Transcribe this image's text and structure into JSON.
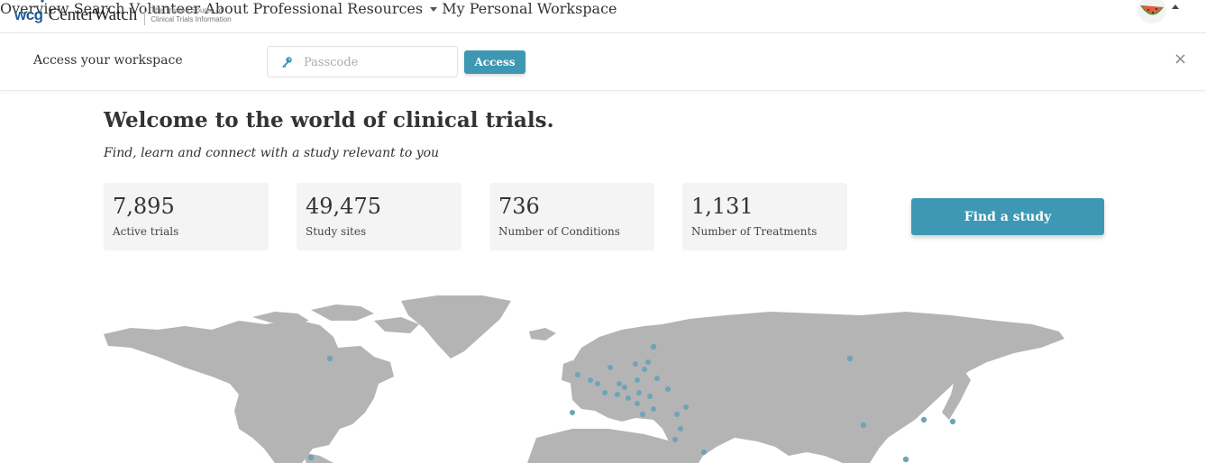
{
  "header": {
    "logo_wcg": "wcg",
    "logo_name": "CenterWatch",
    "tagline": "The Trusted Source of Clinical Trials Information",
    "nav": [
      {
        "label": "Overview"
      },
      {
        "label": "Search"
      },
      {
        "label": "Volunteer"
      },
      {
        "label": "About"
      },
      {
        "label": "Professional Resources"
      },
      {
        "label": "My Personal Workspace"
      }
    ]
  },
  "workspace": {
    "label": "Access your workspace",
    "passcode_placeholder": "Passcode",
    "access_label": "Access",
    "close_label": "×"
  },
  "hero": {
    "title": "Welcome to the world of clinical trials.",
    "subtitle": "Find, learn and connect with a study relevant to you",
    "stats": [
      {
        "value": "7,895",
        "label": "Active trials"
      },
      {
        "value": "49,475",
        "label": "Study sites"
      },
      {
        "value": "736",
        "label": "Number of Conditions"
      },
      {
        "value": "1,131",
        "label": "Number of Treatments"
      }
    ],
    "find_label": "Find a study"
  },
  "colors": {
    "accent": "#3e98b3",
    "map_land": "#b4b4b4",
    "map_dot": "#6fa3b8",
    "brand": "#1f5d99"
  },
  "icons": {
    "passcode": "key-icon",
    "dropdown": "chevron-down-icon",
    "close": "close-icon"
  }
}
